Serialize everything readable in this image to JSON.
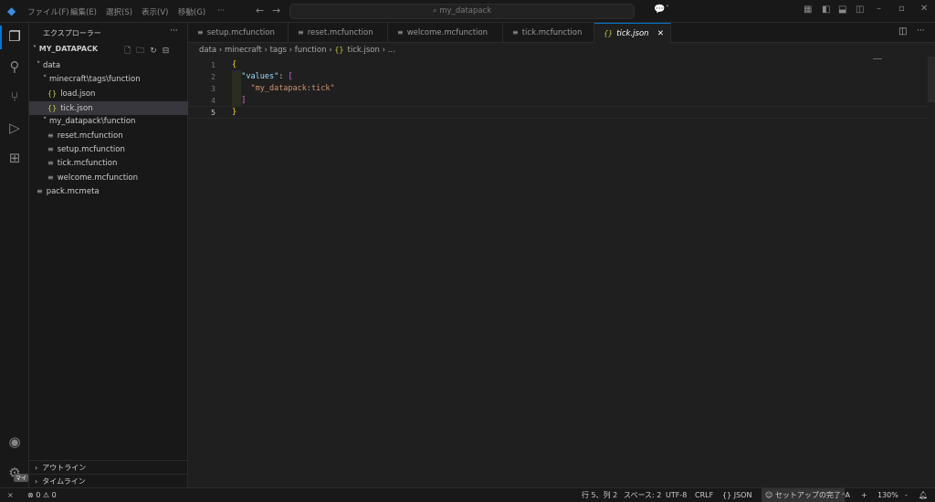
{
  "titlebar": {
    "menus": [
      "ファイル(F)",
      "編集(E)",
      "選択(S)",
      "表示(V)",
      "移動(G)",
      "···"
    ],
    "search": "my_datapack"
  },
  "sidebar": {
    "title": "エクスプローラー",
    "more": "···",
    "root": "MY_DATAPACK",
    "tree": [
      {
        "label": "data",
        "indent": 1,
        "type": "folder"
      },
      {
        "label": "minecraft\\tags\\function",
        "indent": 2,
        "type": "folder"
      },
      {
        "label": "load.json",
        "indent": 3,
        "type": "json"
      },
      {
        "label": "tick.json",
        "indent": 3,
        "type": "json",
        "selected": true
      },
      {
        "label": "my_datapack\\function",
        "indent": 2,
        "type": "folder"
      },
      {
        "label": "reset.mcfunction",
        "indent": 3,
        "type": "file"
      },
      {
        "label": "setup.mcfunction",
        "indent": 3,
        "type": "file"
      },
      {
        "label": "tick.mcfunction",
        "indent": 3,
        "type": "file"
      },
      {
        "label": "welcome.mcfunction",
        "indent": 3,
        "type": "file"
      },
      {
        "label": "pack.mcmeta",
        "indent": 1,
        "type": "file"
      }
    ],
    "outline": "アウトライン",
    "timeline": "タイムライン"
  },
  "tabs": [
    {
      "label": "setup.mcfunction"
    },
    {
      "label": "reset.mcfunction"
    },
    {
      "label": "welcome.mcfunction"
    },
    {
      "label": "tick.mcfunction"
    },
    {
      "label": "tick.json",
      "active": true
    }
  ],
  "breadcrumb": [
    "data",
    "minecraft",
    "tags",
    "function",
    "tick.json",
    "..."
  ],
  "editor": {
    "lines": [
      "{",
      "  \"values\": [",
      "    \"my_datapack:tick\"",
      "  ]",
      "}"
    ]
  },
  "accounts_badge": "マイ",
  "status": {
    "errors": "0",
    "warnings": "0",
    "position": "行 5、列 2",
    "spaces": "スペース: 2",
    "encoding": "UTF-8",
    "eol": "CRLF",
    "language": "JSON",
    "setup": "セットアップの完了",
    "zoom": "130%",
    "plus": "+",
    "minus": "-"
  },
  "colors": {
    "accent": "#0078d4",
    "json_icon": "#cbcb41",
    "bracket1": "#ffd700",
    "bracket2": "#da70d6",
    "key": "#9cdcfe",
    "string": "#ce9178"
  }
}
